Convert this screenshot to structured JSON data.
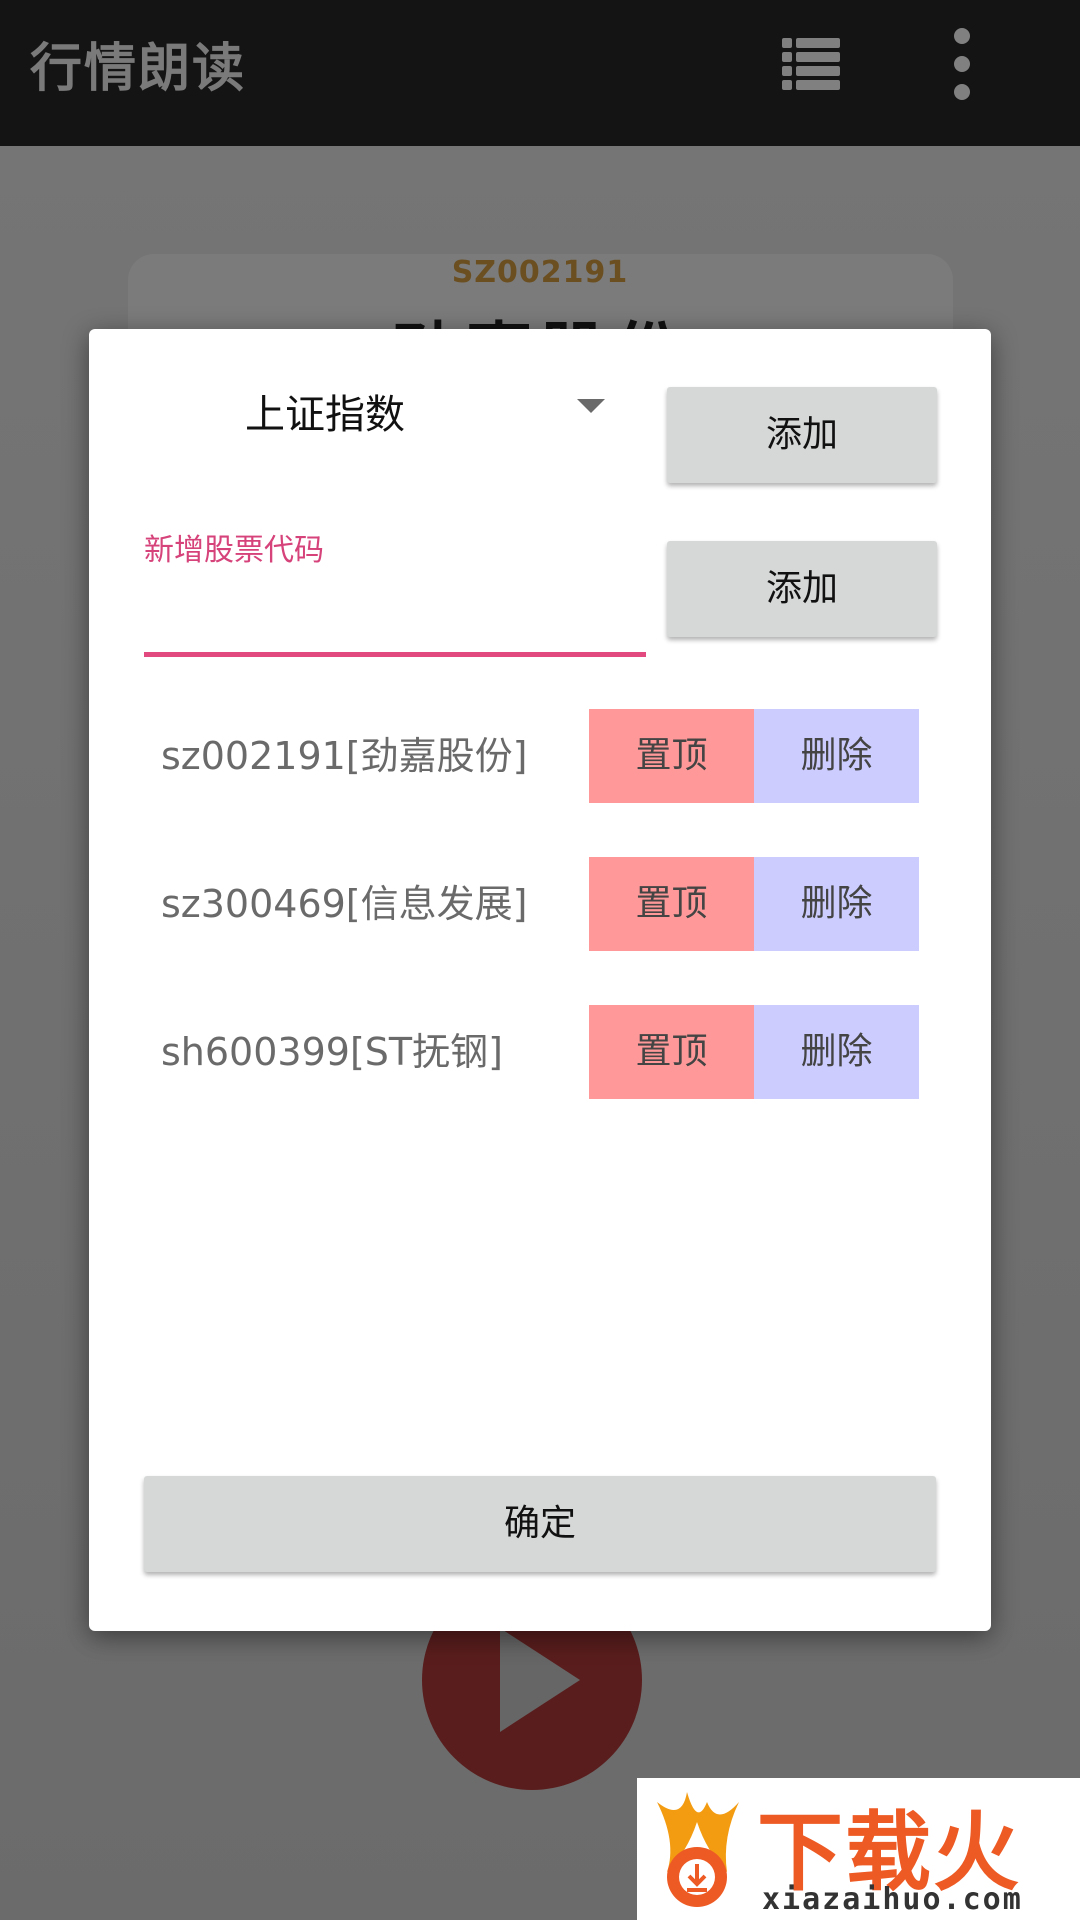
{
  "appbar": {
    "title": "行情朗读",
    "icons": [
      "list-icon",
      "more-vert-icon"
    ]
  },
  "background": {
    "stock_code": "SZ002191",
    "stock_name": "劲嘉股份"
  },
  "dialog": {
    "spinner_value": "上证指数",
    "add_label_1": "添加",
    "input_label": "新增股票代码",
    "input_value": "",
    "add_label_2": "添加",
    "stocks": [
      {
        "label": "sz002191[劲嘉股份]",
        "top_label": "置顶",
        "delete_label": "删除"
      },
      {
        "label": "sz300469[信息发展]",
        "top_label": "置顶",
        "delete_label": "删除"
      },
      {
        "label": "sh600399[ST抚钢]",
        "top_label": "置顶",
        "delete_label": "删除"
      }
    ],
    "ok_label": "确定"
  },
  "watermark": {
    "text": "下载火",
    "url": "xiazaihuo.com"
  },
  "colors": {
    "accent_pink": "#e2497f",
    "top_button": "#ff9999",
    "delete_button": "#ccccff",
    "gray_button": "#d6d7d7"
  }
}
